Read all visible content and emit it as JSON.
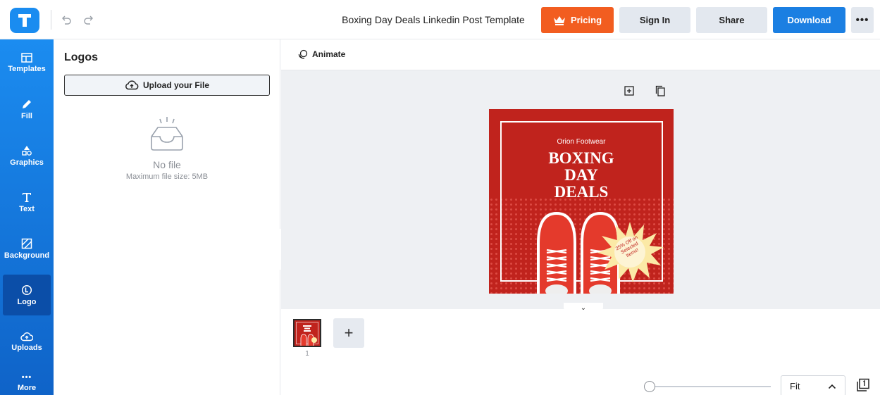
{
  "app": {
    "logo_letter": "T",
    "document_title": "Boxing Day Deals Linkedin Post Template",
    "accent": "#1b7fe2",
    "pricing_color": "#f25d20"
  },
  "toolbar": {
    "undo_icon": "undo-icon",
    "redo_icon": "redo-icon",
    "pricing_label": "Pricing",
    "signin_label": "Sign In",
    "share_label": "Share",
    "download_label": "Download",
    "more_label": "•••"
  },
  "sidebar": {
    "items": [
      {
        "label": "Templates",
        "icon": "templates-icon"
      },
      {
        "label": "Fill",
        "icon": "pencil-icon"
      },
      {
        "label": "Graphics",
        "icon": "shapes-icon"
      },
      {
        "label": "Text",
        "icon": "text-icon"
      },
      {
        "label": "Background",
        "icon": "background-icon"
      },
      {
        "label": "Logo",
        "icon": "logo-icon",
        "active": true
      },
      {
        "label": "Uploads",
        "icon": "cloud-upload-icon"
      },
      {
        "label": "More",
        "icon": "more-dots-icon",
        "glyph": "•••"
      }
    ]
  },
  "panel": {
    "title": "Logos",
    "upload_label": "Upload your File",
    "empty_title": "No file",
    "empty_hint": "Maximum file size: 5MB"
  },
  "canvas": {
    "animate_label": "Animate",
    "design": {
      "brand": "Orion Footwear",
      "headline_lines": [
        "BOXING",
        "DAY",
        "DEALS"
      ],
      "badge_lines": [
        "25% Off on",
        "Selected",
        "Items!"
      ]
    }
  },
  "pages": {
    "current_number": "1",
    "add_label": "+"
  },
  "zoom": {
    "fit_label": "Fit",
    "chevron": "^",
    "level_fraction": 0.0
  }
}
